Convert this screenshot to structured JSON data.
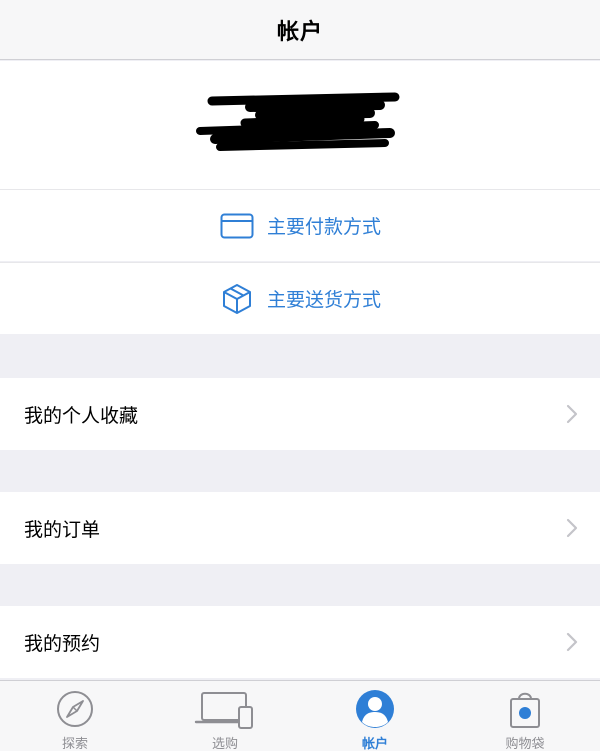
{
  "navbar": {
    "title": "帐户"
  },
  "actions": {
    "payment": "主要付款方式",
    "shipping": "主要送货方式"
  },
  "list": {
    "favorites": "我的个人收藏",
    "orders": "我的订单",
    "reservations": "我的预约"
  },
  "tabs": [
    {
      "label": "探索",
      "icon": "compass-icon"
    },
    {
      "label": "选购",
      "icon": "devices-icon"
    },
    {
      "label": "帐户",
      "icon": "person-icon",
      "active": true
    },
    {
      "label": "购物袋",
      "icon": "bag-icon"
    }
  ],
  "colors": {
    "accent": "#2f7fd6",
    "inactive": "#8e8e93",
    "background": "#efeff4"
  }
}
